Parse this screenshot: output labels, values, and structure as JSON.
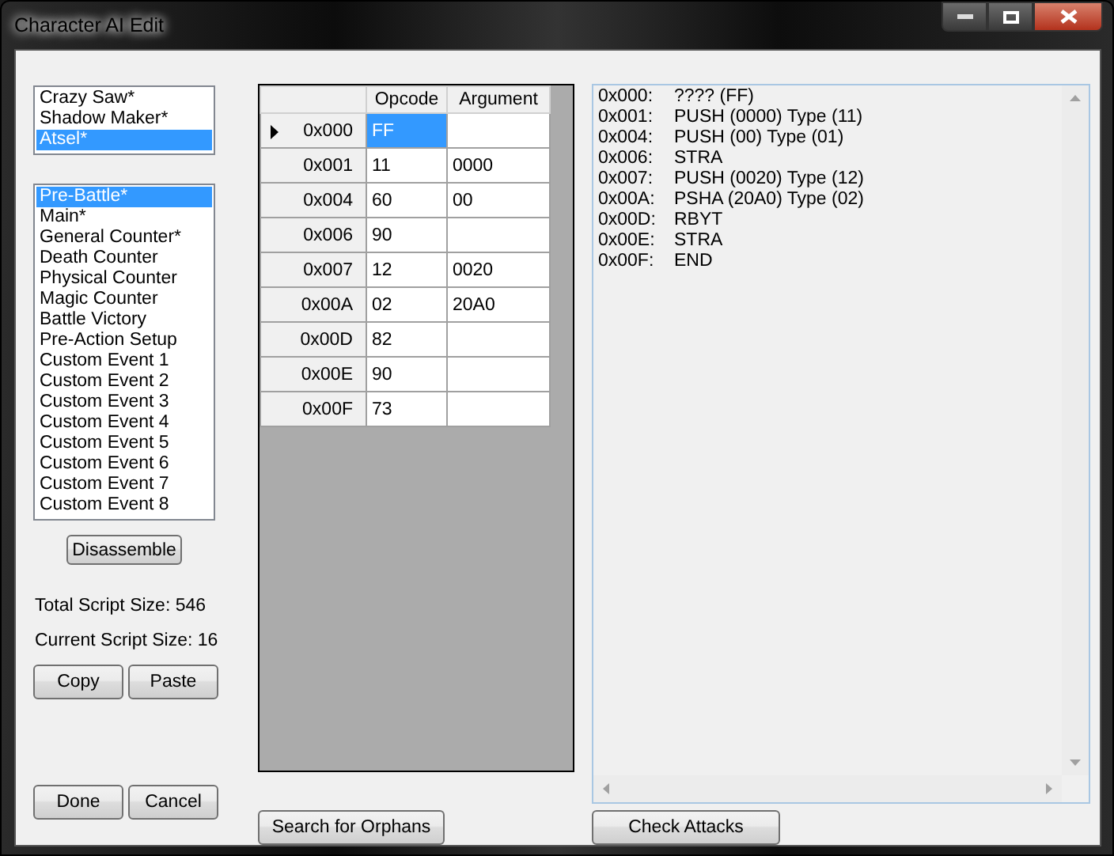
{
  "window": {
    "title": "Character AI Edit"
  },
  "characters": [
    {
      "label": "Crazy Saw*",
      "selected": false
    },
    {
      "label": "Shadow Maker*",
      "selected": false
    },
    {
      "label": "Atsel*",
      "selected": true
    }
  ],
  "scripts": [
    {
      "label": "Pre-Battle*",
      "selected": true
    },
    {
      "label": "Main*",
      "selected": false
    },
    {
      "label": "General Counter*",
      "selected": false
    },
    {
      "label": "Death Counter",
      "selected": false
    },
    {
      "label": "Physical Counter",
      "selected": false
    },
    {
      "label": "Magic Counter",
      "selected": false
    },
    {
      "label": "Battle Victory",
      "selected": false
    },
    {
      "label": "Pre-Action Setup",
      "selected": false
    },
    {
      "label": "Custom Event 1",
      "selected": false
    },
    {
      "label": "Custom Event 2",
      "selected": false
    },
    {
      "label": "Custom Event 3",
      "selected": false
    },
    {
      "label": "Custom Event 4",
      "selected": false
    },
    {
      "label": "Custom Event 5",
      "selected": false
    },
    {
      "label": "Custom Event 6",
      "selected": false
    },
    {
      "label": "Custom Event 7",
      "selected": false
    },
    {
      "label": "Custom Event 8",
      "selected": false
    }
  ],
  "disassemble_button": "Disassemble",
  "total_script_size": "Total Script Size: 546",
  "current_script_size": "Current Script Size: 16",
  "copy_button": "Copy",
  "paste_button": "Paste",
  "done_button": "Done",
  "cancel_button": "Cancel",
  "grid": {
    "columns": [
      "Opcode",
      "Argument"
    ],
    "rows": [
      {
        "address": "0x000",
        "opcode": "FF",
        "selected": true
      },
      {
        "address": "0x001",
        "opcode": "11",
        "argument": "0000",
        "selected": false
      },
      {
        "address": "0x004",
        "opcode": "60",
        "argument": "00",
        "selected": false
      },
      {
        "address": "0x006",
        "opcode": "90",
        "selected": false
      },
      {
        "address": "0x007",
        "opcode": "12",
        "argument": "0020",
        "selected": false
      },
      {
        "address": "0x00A",
        "opcode": "02",
        "argument": "20A0",
        "selected": false
      },
      {
        "address": "0x00D",
        "opcode": "82",
        "selected": false
      },
      {
        "address": "0x00E",
        "opcode": "90",
        "selected": false
      },
      {
        "address": "0x00F",
        "opcode": "73",
        "selected": false
      }
    ]
  },
  "disassembly": [
    {
      "address": "0x000:",
      "text": "???? (FF)"
    },
    {
      "address": "0x001:",
      "text": "PUSH (0000) Type (11)"
    },
    {
      "address": "0x004:",
      "text": "PUSH (00) Type (01)"
    },
    {
      "address": "0x006:",
      "text": "STRA"
    },
    {
      "address": "0x007:",
      "text": "PUSH (0020) Type (12)"
    },
    {
      "address": "0x00A:",
      "text": "PSHA (20A0) Type (02)"
    },
    {
      "address": "0x00D:",
      "text": "RBYT"
    },
    {
      "address": "0x00E:",
      "text": "STRA"
    },
    {
      "address": "0x00F:",
      "text": "END"
    }
  ],
  "search_orphans_button": "Search for Orphans",
  "check_attacks_button": "Check Attacks"
}
